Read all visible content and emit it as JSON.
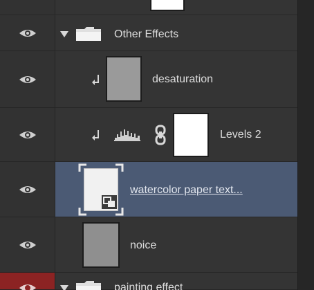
{
  "layers": {
    "group_other_effects": {
      "name": "Other Effects"
    },
    "desaturation": {
      "name": "desaturation"
    },
    "levels": {
      "name": "Levels 2"
    },
    "watercolor": {
      "name": "watercolor paper text..."
    },
    "noice": {
      "name": "noice"
    },
    "group_painting": {
      "name": "painting effect"
    }
  },
  "colors": {
    "panel_bg": "#333333",
    "selected_row": "#4b5a74",
    "text": "#dcdcdc",
    "eye_red": "#8c2323"
  },
  "icons": {
    "visibility": "eye-icon",
    "expand": "triangle-down-icon",
    "folder": "folder-icon",
    "clip": "clipping-arrow-icon",
    "histogram": "levels-histogram-icon",
    "link": "chain-link-icon",
    "smart_object": "smart-object-badge-icon"
  }
}
